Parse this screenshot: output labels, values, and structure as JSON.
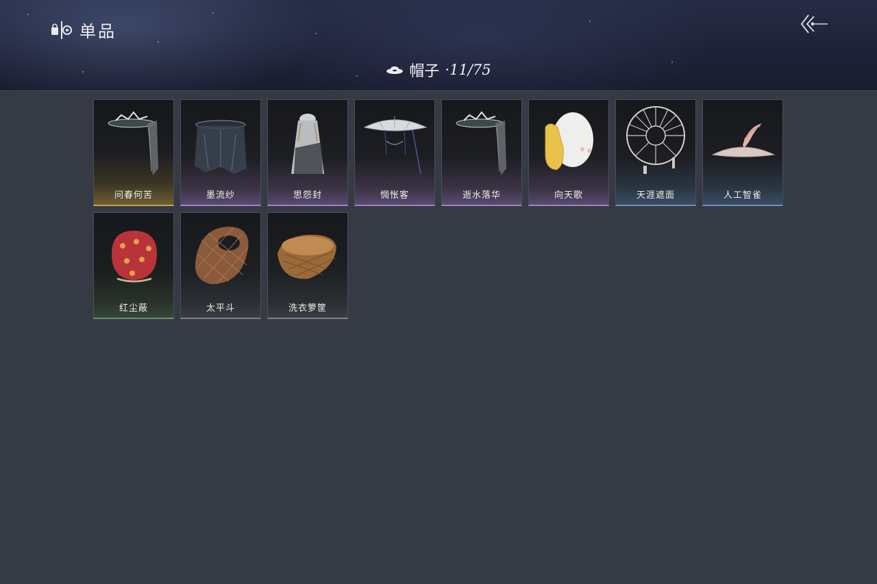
{
  "header": {
    "title": "单品",
    "category": {
      "icon": "hat-icon",
      "name": "帽子",
      "count": "·11/75"
    },
    "back_icon": "back-arrow-icon"
  },
  "colors": {
    "gold": "#c9a54e",
    "purple": "#9c86c4",
    "blue": "#6f8fb8",
    "green": "#6d8c70",
    "gray": "#7f8288",
    "page_background": "#363a44"
  },
  "items": [
    {
      "label": "问春何苦",
      "quality": "gold",
      "icon": "veiled-bamboo-hat-icon"
    },
    {
      "label": "墨流纱",
      "quality": "purple",
      "icon": "black-veil-hat-icon"
    },
    {
      "label": "思怨封",
      "quality": "purple",
      "icon": "hooded-veil-icon"
    },
    {
      "label": "惆怅客",
      "quality": "purple",
      "icon": "conical-hat-icon"
    },
    {
      "label": "逝水落华",
      "quality": "purple",
      "icon": "veiled-bamboo-hat-icon"
    },
    {
      "label": "向天歌",
      "quality": "purple",
      "icon": "goose-hood-icon"
    },
    {
      "label": "天涯遮面",
      "quality": "blue",
      "icon": "spoked-wheel-hat-icon"
    },
    {
      "label": "人工智雀",
      "quality": "blue",
      "icon": "bird-hat-icon"
    },
    {
      "label": "红尘蔽",
      "quality": "green",
      "icon": "red-sack-hood-icon"
    },
    {
      "label": "太平斗",
      "quality": "gray",
      "icon": "wicker-basket-icon"
    },
    {
      "label": "洗衣箩筐",
      "quality": "gray",
      "icon": "laundry-basket-icon"
    }
  ]
}
